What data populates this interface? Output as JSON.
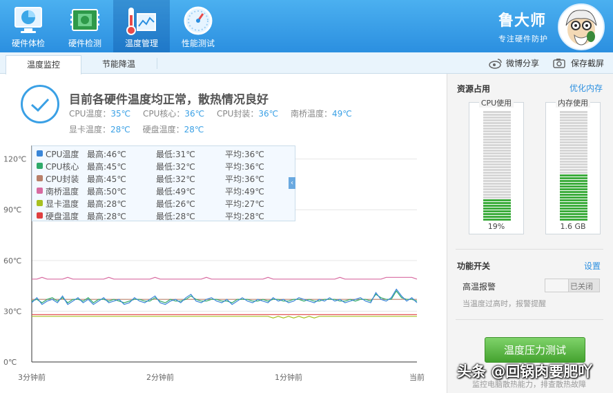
{
  "nav": {
    "tabs": [
      {
        "label": "硬件体检",
        "icon": "monitor-check-icon"
      },
      {
        "label": "硬件检测",
        "icon": "circuit-board-icon"
      },
      {
        "label": "温度管理",
        "icon": "thermometer-chart-icon",
        "active": true
      },
      {
        "label": "性能测试",
        "icon": "speedometer-icon"
      }
    ]
  },
  "brand": {
    "name": "鲁大师",
    "slogan": "专注硬件防护"
  },
  "subtabs": [
    {
      "label": "温度监控",
      "active": true
    },
    {
      "label": "节能降温"
    }
  ],
  "tools": {
    "share_label": "微博分享",
    "screenshot_label": "保存截屏"
  },
  "status": {
    "title": "目前各硬件温度均正常，散热情况良好",
    "readings": [
      {
        "label": "CPU温度：",
        "value": "35℃"
      },
      {
        "label": "CPU核心：",
        "value": "36℃"
      },
      {
        "label": "CPU封装：",
        "value": "36℃"
      },
      {
        "label": "南桥温度：",
        "value": "49℃"
      },
      {
        "label": "显卡温度：",
        "value": "28℃"
      },
      {
        "label": "硬盘温度：",
        "value": "28℃"
      }
    ]
  },
  "legend": [
    {
      "name": "CPU温度",
      "max": "最高:46℃",
      "min": "最低:31℃",
      "avg": "平均:36℃",
      "color": "#3a86d8"
    },
    {
      "name": "CPU核心",
      "max": "最高:45℃",
      "min": "最低:32℃",
      "avg": "平均:36℃",
      "color": "#2faa6a"
    },
    {
      "name": "CPU封装",
      "max": "最高:45℃",
      "min": "最低:32℃",
      "avg": "平均:36℃",
      "color": "#b9806a"
    },
    {
      "name": "南桥温度",
      "max": "最高:50℃",
      "min": "最低:49℃",
      "avg": "平均:49℃",
      "color": "#d86aa0"
    },
    {
      "name": "显卡温度",
      "max": "最高:28℃",
      "min": "最低:26℃",
      "avg": "平均:27℃",
      "color": "#a8c020"
    },
    {
      "name": "硬盘温度",
      "max": "最高:28℃",
      "min": "最低:28℃",
      "avg": "平均:28℃",
      "color": "#e04040"
    }
  ],
  "chart_data": {
    "type": "line",
    "x_tick_labels": [
      "3分钟前",
      "2分钟前",
      "1分钟前",
      "当前"
    ],
    "y_tick_labels": [
      "0℃",
      "30℃",
      "60℃",
      "90℃",
      "120℃"
    ],
    "ylim": [
      0,
      128
    ],
    "series": [
      {
        "name": "CPU温度",
        "color": "#3a86d8",
        "values": [
          35,
          38,
          34,
          36,
          37,
          35,
          39,
          34,
          36,
          38,
          35,
          37,
          34,
          36,
          38,
          35,
          36,
          37,
          34,
          35,
          38,
          36,
          35,
          37,
          39,
          35,
          34,
          36,
          37,
          35,
          38,
          40,
          36,
          35,
          37,
          38,
          36,
          35,
          37,
          34,
          36,
          38,
          36,
          35,
          37,
          36,
          35,
          38,
          36,
          37,
          35,
          36,
          38,
          37,
          36,
          35,
          37,
          36,
          38,
          36,
          37,
          35,
          36,
          37,
          38,
          36,
          35,
          41,
          37,
          36,
          38,
          43,
          39,
          36,
          38,
          35
        ]
      },
      {
        "name": "CPU核心",
        "color": "#2faa6a",
        "values": [
          36,
          37,
          35,
          37,
          38,
          36,
          38,
          35,
          37,
          37,
          36,
          38,
          35,
          37,
          37,
          36,
          37,
          36,
          35,
          36,
          37,
          37,
          36,
          36,
          38,
          36,
          35,
          37,
          36,
          36,
          37,
          39,
          37,
          36,
          36,
          37,
          37,
          36,
          36,
          35,
          37,
          37,
          37,
          36,
          36,
          37,
          36,
          37,
          37,
          36,
          36,
          37,
          37,
          36,
          37,
          36,
          36,
          37,
          37,
          37,
          36,
          36,
          37,
          36,
          37,
          37,
          36,
          40,
          38,
          37,
          37,
          42,
          38,
          37,
          37,
          36
        ]
      },
      {
        "name": "CPU封装",
        "color": "#b9806a",
        "values": [
          37,
          37,
          37,
          37,
          37,
          37,
          37,
          37,
          37,
          37,
          37,
          37,
          37,
          37,
          37,
          37,
          37,
          37,
          37,
          37,
          37,
          37,
          37,
          37,
          37,
          37,
          37,
          37,
          37,
          37,
          37,
          37,
          37,
          37,
          37,
          37,
          37,
          37,
          37,
          37,
          37,
          37,
          37,
          37,
          37,
          37,
          37,
          37,
          37,
          37,
          37,
          37,
          37,
          37,
          37,
          37,
          37,
          37,
          37,
          37,
          37,
          37,
          37,
          37,
          37,
          37,
          37,
          37,
          37,
          37,
          37,
          37,
          37,
          37,
          37,
          37
        ]
      },
      {
        "name": "南桥温度",
        "color": "#d86aa0",
        "values": [
          49,
          49,
          50,
          49,
          49,
          49,
          49,
          50,
          49,
          49,
          49,
          49,
          49,
          49,
          49,
          50,
          49,
          49,
          49,
          49,
          49,
          49,
          49,
          49,
          50,
          49,
          49,
          49,
          49,
          49,
          49,
          49,
          49,
          49,
          50,
          49,
          49,
          49,
          49,
          49,
          49,
          49,
          49,
          49,
          49,
          49,
          50,
          49,
          49,
          49,
          49,
          49,
          49,
          49,
          49,
          49,
          49,
          49,
          49,
          49,
          50,
          49,
          49,
          49,
          49,
          49,
          49,
          49,
          49,
          50,
          50,
          50,
          50,
          50,
          50,
          49
        ]
      },
      {
        "name": "显卡温度",
        "color": "#a8c020",
        "values": [
          27,
          27,
          27,
          27,
          27,
          27,
          27,
          27,
          27,
          27,
          27,
          27,
          27,
          27,
          27,
          27,
          27,
          27,
          27,
          27,
          27,
          27,
          27,
          27,
          27,
          27,
          27,
          27,
          27,
          27,
          27,
          27,
          27,
          27,
          27,
          27,
          27,
          27,
          27,
          27,
          27,
          27,
          27,
          27,
          27,
          27,
          27,
          26,
          27,
          26,
          27,
          26,
          27,
          26,
          27,
          26,
          27,
          27,
          27,
          27,
          27,
          27,
          27,
          27,
          27,
          27,
          27,
          27,
          27,
          27,
          27,
          27,
          27,
          27,
          27,
          27
        ]
      },
      {
        "name": "硬盘温度",
        "color": "#e04040",
        "values": [
          28,
          28,
          28,
          28,
          28,
          28,
          28,
          28,
          28,
          28,
          28,
          28,
          28,
          28,
          28,
          28,
          28,
          28,
          28,
          28,
          28,
          28,
          28,
          28,
          28,
          28,
          28,
          28,
          28,
          28,
          28,
          28,
          28,
          28,
          28,
          28,
          28,
          28,
          28,
          28,
          28,
          28,
          28,
          28,
          28,
          28,
          28,
          28,
          28,
          28,
          28,
          28,
          28,
          28,
          28,
          28,
          28,
          28,
          28,
          28,
          28,
          28,
          28,
          28,
          28,
          28,
          28,
          28,
          28,
          28,
          28,
          28,
          28,
          28,
          28,
          28
        ]
      }
    ]
  },
  "resources": {
    "title": "资源占用",
    "optimize_label": "优化内存",
    "cpu": {
      "label": "CPU使用",
      "value": "19%",
      "fraction": 0.19
    },
    "memory": {
      "label": "内存使用",
      "value": "1.6 GB",
      "fraction": 0.42
    }
  },
  "features": {
    "title": "功能开关",
    "settings_label": "设置",
    "alarm_label": "高温报警",
    "alarm_state": "已关闭",
    "alarm_desc": "当温度过高时，报警提醒"
  },
  "stress": {
    "button_label": "温度压力测试",
    "desc": "监控电脑散热能力，排查散热故障"
  },
  "watermark": "头条 @回锅肉要肥吖",
  "colors": {
    "accent": "#2b8fe0",
    "green_bar": "#3cac3c",
    "empty_bar": "#d6d6d6"
  }
}
